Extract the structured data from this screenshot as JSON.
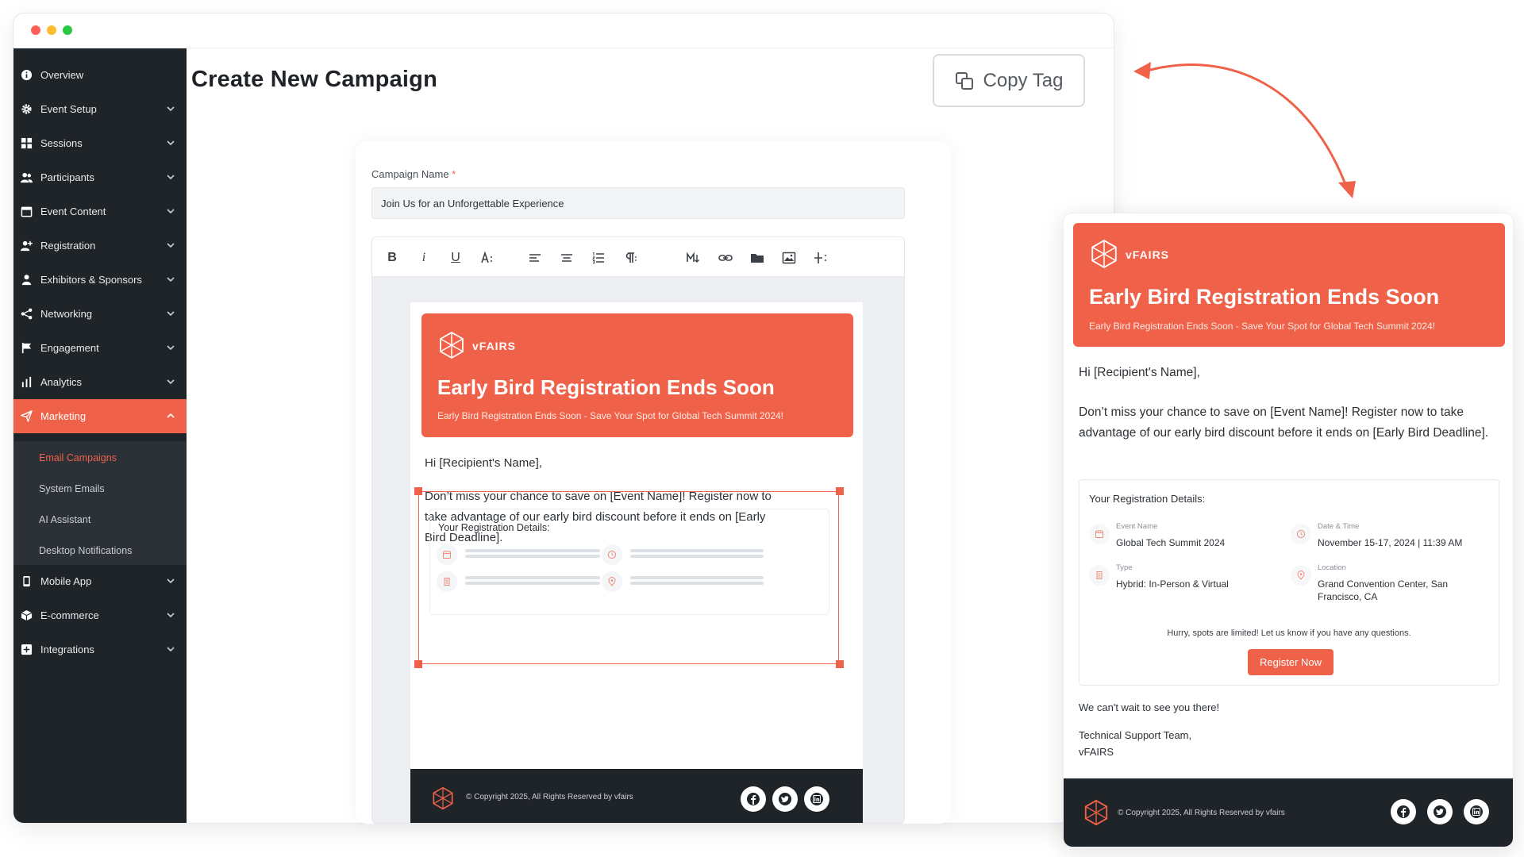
{
  "window": {
    "title": ""
  },
  "sidebar": {
    "items": [
      {
        "label": "Overview",
        "icon": "info-icon"
      },
      {
        "label": "Event Setup",
        "icon": "gear-icon"
      },
      {
        "label": "Sessions",
        "icon": "grid-icon"
      },
      {
        "label": "Participants",
        "icon": "users-icon"
      },
      {
        "label": "Event Content",
        "icon": "calendar-icon"
      },
      {
        "label": "Registration",
        "icon": "user-plus-icon"
      },
      {
        "label": "Exhibitors & Sponsors",
        "icon": "user-icon"
      },
      {
        "label": "Networking",
        "icon": "share-icon"
      },
      {
        "label": "Engagement",
        "icon": "flag-icon"
      },
      {
        "label": "Analytics",
        "icon": "bar-chart-icon"
      },
      {
        "label": "Marketing",
        "icon": "send-icon"
      },
      {
        "label": "Mobile App",
        "icon": "mobile-icon"
      },
      {
        "label": "E-commerce",
        "icon": "box-icon"
      },
      {
        "label": "Integrations",
        "icon": "plus-square-icon"
      }
    ],
    "marketing_sub": [
      "Email Campaigns",
      "System Emails",
      "AI Assistant",
      "Desktop Notifications"
    ]
  },
  "main": {
    "title": "Create New Campaign",
    "copy_tag_label": "Copy Tag",
    "campaign_name_label": "Campaign Name",
    "required_mark": "*",
    "campaign_name_value": "Join Us for an Unforgettable Experience"
  },
  "email": {
    "brand": "vFAIRS",
    "headline": "Early Bird Registration Ends Soon",
    "subheadline": "Early Bird Registration Ends Soon - Save Your Spot for Global Tech Summit 2024!",
    "greeting": "Hi [Recipient's Name],",
    "body": "Don’t miss your chance to save on [Event Name]! Register now to take advantage of our early bird discount before it ends on [Early Bird Deadline].",
    "details_title": "Your Registration Details:",
    "details": [
      {
        "label": "Event Name",
        "value": "Global Tech Summit 2024"
      },
      {
        "label": "Date & Time",
        "value": "November 15-17, 2024 | 11:39 AM"
      },
      {
        "label": "Type",
        "value": "Hybrid: In-Person & Virtual"
      },
      {
        "label": "Location",
        "value": "Grand Convention Center, San Francisco, CA"
      }
    ],
    "hurry": "Hurry, spots are limited! Let us know if you have any questions.",
    "cta": "Register Now",
    "closing": "We can't wait to see you there!",
    "signoff_1": "Technical Support Team,",
    "signoff_2": "vFAIRS",
    "copyright": "© Copyright 2025, All Rights Reserved by vfairs"
  },
  "colors": {
    "accent": "#ef6148",
    "sidebar_bg": "#1f2429",
    "footer_bg": "#1f2429"
  }
}
